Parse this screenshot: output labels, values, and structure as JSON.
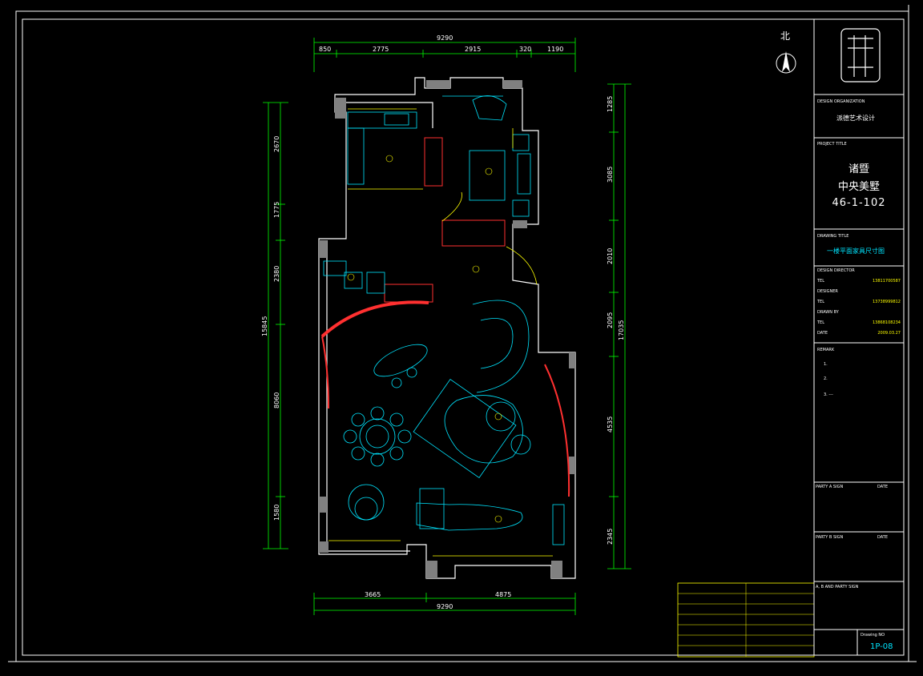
{
  "drawing": {
    "north_label": "北",
    "dims_top": [
      "9290",
      "850",
      "2775",
      "2915",
      "320",
      "1190"
    ],
    "dims_bottom": [
      "3665",
      "4875",
      "9290"
    ],
    "dims_left": [
      "2670",
      "1775",
      "2380",
      "15845",
      "8060",
      "1580"
    ],
    "dims_right": [
      "1285",
      "3085",
      "2010",
      "17035",
      "2095",
      "4535",
      "2345"
    ]
  },
  "title_block": {
    "design_org_label": "DESIGN ORGANIZATION",
    "design_org_value": "派德艺术设计",
    "project_title_label": "PROJECT TITLE",
    "project_lines": [
      "诸暨",
      "中央美墅",
      "46-1-102"
    ],
    "drawing_title_label": "DRAWING TITLE",
    "drawing_title_value": "一楼平面家具尺寸图",
    "rows": [
      {
        "label": "DESIGN DIRECTOR",
        "value": ""
      },
      {
        "label": "TEL",
        "value": "13811700587"
      },
      {
        "label": "DESIGNER",
        "value": ""
      },
      {
        "label": "TEL",
        "value": "13738999812"
      },
      {
        "label": "DRAWN BY",
        "value": ""
      },
      {
        "label": "TEL",
        "value": "13868108234"
      },
      {
        "label": "DATE",
        "value": "2009.03.27"
      }
    ],
    "remark_label": "REMARK",
    "remarks": [
      "1.",
      "2.",
      "3. ---"
    ],
    "party_a_label": "PARTY A SIGN",
    "party_b_label": "PARTY B SIGN",
    "date_label": "DATE",
    "ab_label": "A, B AND PARTY SIGN",
    "drawing_no_label": "Drawing NO",
    "drawing_no": "1P-08"
  }
}
